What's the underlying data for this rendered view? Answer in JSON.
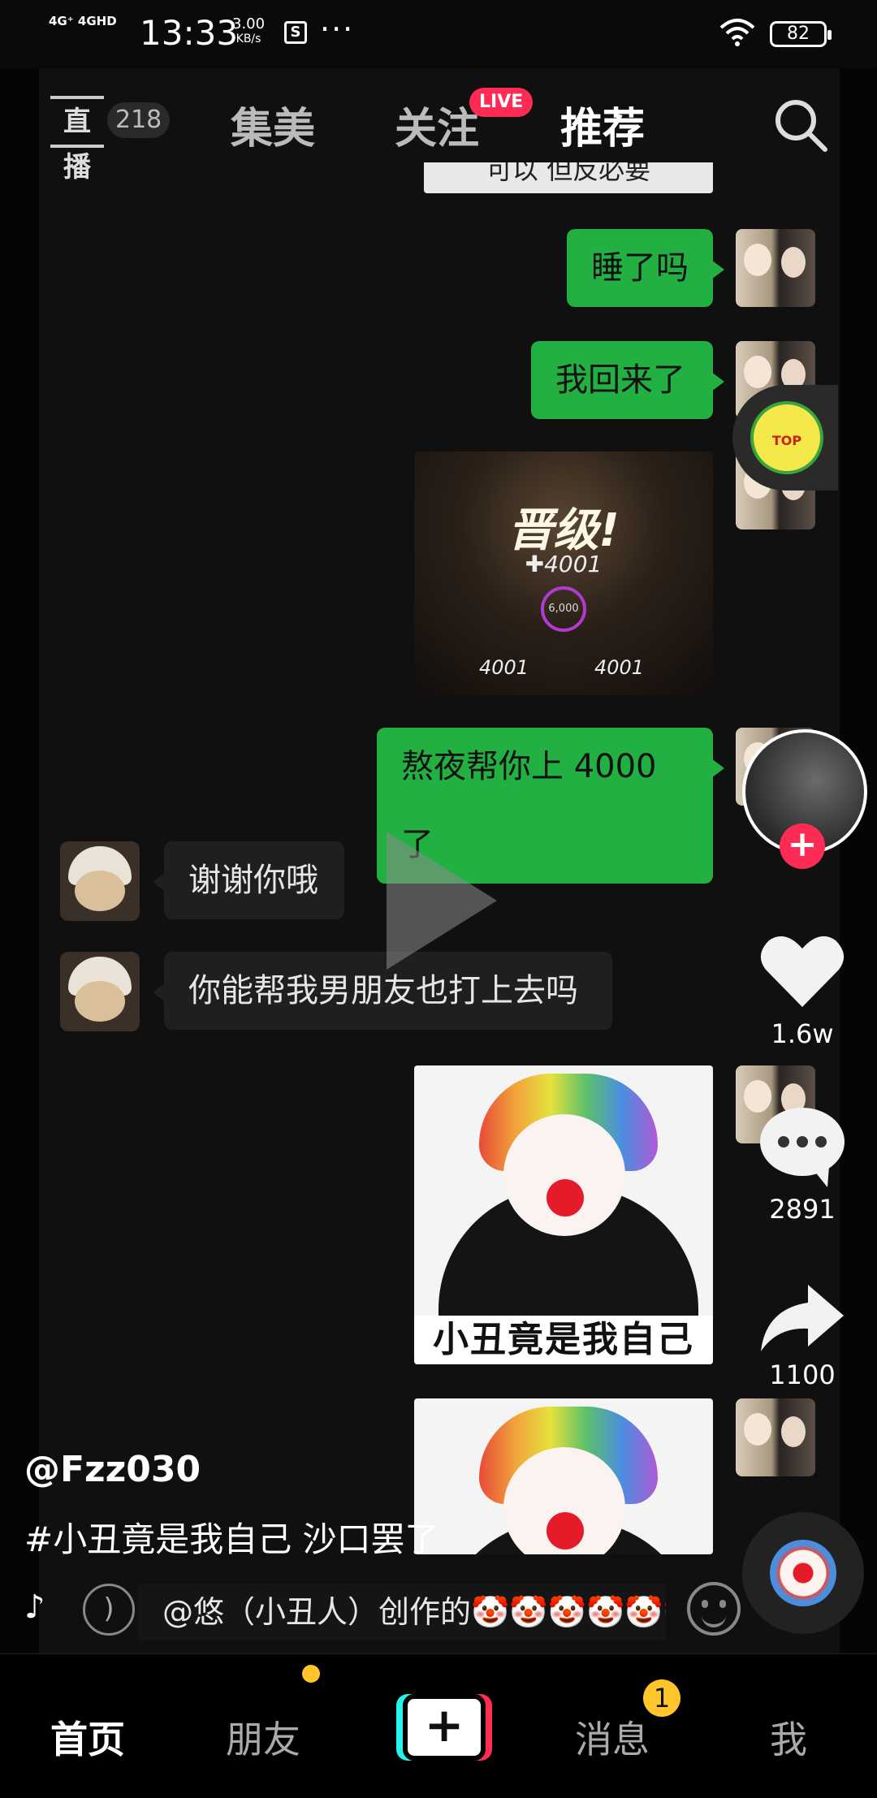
{
  "status_bar": {
    "network": "4G⁺ 4GHD",
    "time": "13:33",
    "speed": "3.00",
    "speed_unit": "KB/s",
    "battery": "82"
  },
  "top_nav": {
    "live_label": "直播",
    "live_count": "218",
    "tabs": [
      "集美",
      "关注",
      "推荐"
    ],
    "active_tab": "推荐",
    "live_badge": "LIVE"
  },
  "chat": {
    "partial_text": "可以 但反必要",
    "messages": [
      {
        "side": "out",
        "text": "睡了吗"
      },
      {
        "side": "out",
        "text": "我回来了"
      },
      {
        "side": "out",
        "text": "熬夜帮你上 4000 了"
      },
      {
        "side": "in",
        "text": "谢谢你哦"
      },
      {
        "side": "in",
        "text": "你能帮我男朋友也打上去吗"
      }
    ],
    "game_card": {
      "title": "晋级!",
      "score": "✚4001",
      "ring": "6,000",
      "bottom_left": "4001",
      "bottom_right": "4001"
    },
    "meme_caption": "小丑竟是我自己"
  },
  "actions": {
    "likes": "1.6w",
    "comments": "2891",
    "shares": "1100"
  },
  "caption": {
    "author": "@Fzz030",
    "description": "#小丑竟是我自己 沙口罢了",
    "music_text": "@悠（小丑人）创作的🤡🤡🤡🤡🤡🤡"
  },
  "bottom_nav": {
    "items": [
      "首页",
      "朋友",
      "消息",
      "我"
    ],
    "message_badge": "1"
  },
  "colors": {
    "accent": "#fe2c55",
    "out_bubble": "#23b043",
    "badge": "#ffc52b"
  }
}
